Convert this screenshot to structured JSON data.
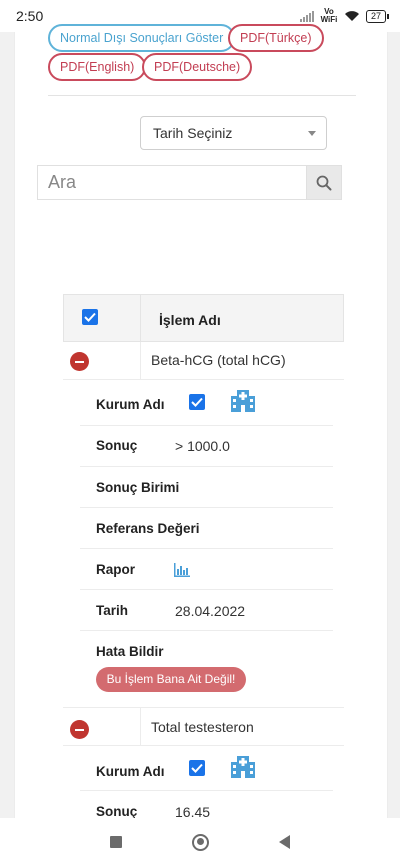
{
  "status": {
    "time": "2:50",
    "network": "Vo WiFi",
    "battery": "27"
  },
  "filters": {
    "abnormal_results": "Normal Dışı Sonuçları Göster",
    "pdf_tr": "PDF(Türkçe)",
    "pdf_en": "PDF(English)",
    "pdf_de": "PDF(Deutsche)"
  },
  "date_select": {
    "label": "Tarih Seçiniz"
  },
  "search": {
    "placeholder": "Ara"
  },
  "table": {
    "header": "İşlem Adı",
    "rows": [
      {
        "title": "Beta-hCG (total hCG)",
        "details": {
          "institution_label": "Kurum Adı",
          "result_label": "Sonuç",
          "result_value": "> 1000.0",
          "unit_label": "Sonuç Birimi",
          "reference_label": "Referans Değeri",
          "report_label": "Rapor",
          "date_label": "Tarih",
          "date_value": "28.04.2022",
          "error_label": "Hata Bildir",
          "error_button": "Bu İşlem Bana Ait Değil!"
        }
      },
      {
        "title": "Total testesteron",
        "details": {
          "institution_label": "Kurum Adı",
          "result_label": "Sonuç",
          "result_value": "16.45"
        }
      }
    ]
  },
  "colors": {
    "accent_blue": "#1a73e8",
    "pill_blue": "#5fb3d9",
    "pill_red": "#c94a5c",
    "remove_red": "#c0352f",
    "report_button": "#d36b6f",
    "icon_blue": "#4a9fd8"
  },
  "icons": {
    "hospital": "hospital-icon",
    "report": "bar-chart-icon",
    "search": "search-icon"
  }
}
